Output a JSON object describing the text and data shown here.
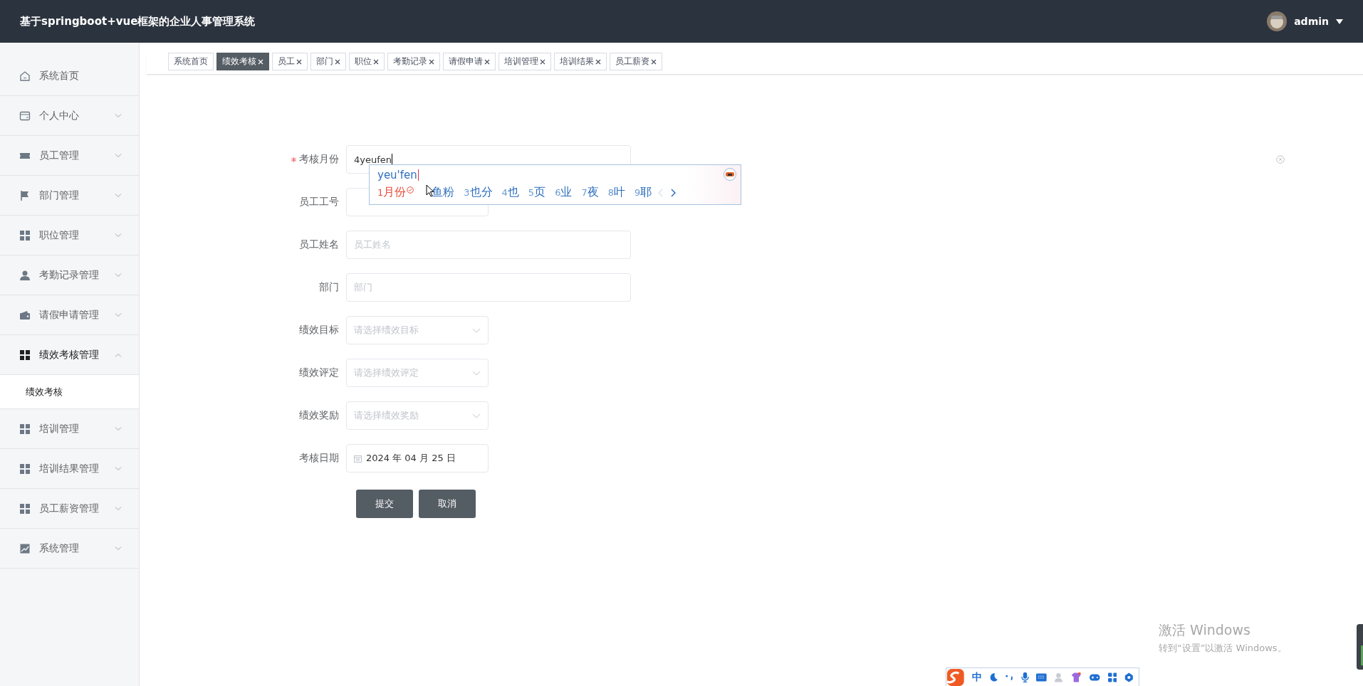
{
  "header": {
    "title": "基于springboot+vue框架的企业人事管理系统",
    "user": {
      "name": "admin"
    }
  },
  "sidebar": {
    "items": [
      {
        "label": "系统首页",
        "kind": "link",
        "expanded": false
      },
      {
        "label": "个人中心",
        "kind": "submenu",
        "expanded": false
      },
      {
        "label": "员工管理",
        "kind": "submenu",
        "expanded": false
      },
      {
        "label": "部门管理",
        "kind": "submenu",
        "expanded": false
      },
      {
        "label": "职位管理",
        "kind": "submenu",
        "expanded": false
      },
      {
        "label": "考勤记录管理",
        "kind": "submenu",
        "expanded": false
      },
      {
        "label": "请假申请管理",
        "kind": "submenu",
        "expanded": false
      },
      {
        "label": "绩效考核管理",
        "kind": "submenu",
        "expanded": true,
        "children": [
          {
            "label": "绩效考核",
            "selected": true
          }
        ]
      },
      {
        "label": "培训管理",
        "kind": "submenu",
        "expanded": false
      },
      {
        "label": "培训结果管理",
        "kind": "submenu",
        "expanded": false
      },
      {
        "label": "员工薪资管理",
        "kind": "submenu",
        "expanded": false
      },
      {
        "label": "系统管理",
        "kind": "submenu",
        "expanded": false
      }
    ]
  },
  "tabs": [
    {
      "label": "系统首页",
      "selected": false,
      "closable": false
    },
    {
      "label": "绩效考核",
      "selected": true,
      "closable": true
    },
    {
      "label": "员工",
      "selected": false,
      "closable": true
    },
    {
      "label": "部门",
      "selected": false,
      "closable": true
    },
    {
      "label": "职位",
      "selected": false,
      "closable": true
    },
    {
      "label": "考勤记录",
      "selected": false,
      "closable": true
    },
    {
      "label": "请假申请",
      "selected": false,
      "closable": true
    },
    {
      "label": "培训管理",
      "selected": false,
      "closable": true
    },
    {
      "label": "培训结果",
      "selected": false,
      "closable": true
    },
    {
      "label": "员工薪资",
      "selected": false,
      "closable": true
    }
  ],
  "form": {
    "fields": [
      {
        "kind": "text",
        "label": "考核月份",
        "required": true,
        "value": "4yeufen",
        "focused": true,
        "clearable": true
      },
      {
        "kind": "number",
        "label": "员工工号",
        "required": false,
        "focused": false,
        "clearable": false
      },
      {
        "kind": "text",
        "label": "员工姓名",
        "required": false,
        "placeholder": "员工姓名",
        "focused": false,
        "clearable": false
      },
      {
        "kind": "text",
        "label": "部门",
        "required": false,
        "placeholder": "部门",
        "focused": false,
        "clearable": false
      },
      {
        "kind": "select",
        "label": "绩效目标",
        "required": false,
        "placeholder": "请选择绩效目标"
      },
      {
        "kind": "select",
        "label": "绩效评定",
        "required": false,
        "placeholder": "请选择绩效评定"
      },
      {
        "kind": "select",
        "label": "绩效奖励",
        "required": false,
        "placeholder": "请选择绩效奖励"
      },
      {
        "kind": "date",
        "label": "考核日期",
        "required": false,
        "value": "2024 年 04 月 25 日"
      }
    ],
    "buttons": [
      "提交",
      "取消"
    ]
  },
  "ime_popup": {
    "composition": "yeu'fen",
    "candidates": [
      {
        "number": "1",
        "text": "月份",
        "selected": true
      },
      {
        "text": "鱼粉",
        "selected": false
      },
      {
        "number": "3",
        "text": "也分",
        "selected": false
      },
      {
        "number": "4",
        "text": "也",
        "selected": false
      },
      {
        "number": "5",
        "text": "页",
        "selected": false
      },
      {
        "number": "6",
        "text": "业",
        "selected": false
      },
      {
        "number": "7",
        "text": "夜",
        "selected": false
      },
      {
        "number": "8",
        "text": "叶",
        "selected": false
      },
      {
        "number": "9",
        "text": "耶",
        "selected": false
      }
    ],
    "prev_disabled": true,
    "next_disabled": false
  },
  "ime_toolbar": {
    "mode": "中"
  },
  "os_overlay": {
    "title": "激活 Windows",
    "subtitle": "转到“设置”以激活 Windows。"
  }
}
